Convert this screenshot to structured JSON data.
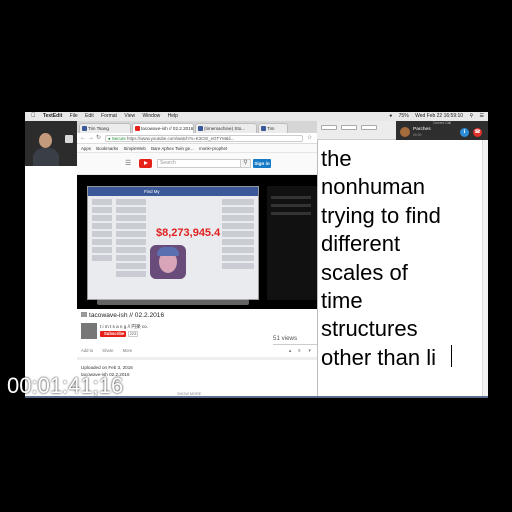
{
  "menubar": {
    "app": "TextEdit",
    "items": [
      "File",
      "Edit",
      "Format",
      "View",
      "Window",
      "Help"
    ],
    "clock": "Wed Feb 22  16:59:10",
    "battery": "75%"
  },
  "browser": {
    "tabs": [
      {
        "label": "Tim Tsang",
        "color": "#3b5998"
      },
      {
        "label": "tacowave-ish // 02.2.2016",
        "color": "#e62117"
      },
      {
        "label": "(timemachine) Sto...",
        "color": "#3b5998"
      },
      {
        "label": "Tim",
        "color": "#3b5998"
      }
    ],
    "secure_label": "Secure",
    "url": "https://www.youtube.com/watch?v=K3C8r_eGTYM&li...",
    "bookmarks": [
      "Apps",
      "Bookmarks",
      "SimpleWeb",
      "Bare Aphex Twin ge...",
      "monk+prophet"
    ]
  },
  "youtube": {
    "search_placeholder": "Search",
    "signin_label": "Sign in",
    "video": {
      "overlay_amount": "$8,273,945.4",
      "facebook_title": "Find My"
    },
    "title": "tacowave-ish // 02.2.2016",
    "channel_name": "t i m t s a n g // 円楽 co.",
    "subscribe_label": "Subscribe",
    "subscriber_count": "223",
    "views": "51 views",
    "actions": [
      "Add to",
      "Share",
      "More"
    ],
    "likes": "9",
    "dislikes": "0",
    "uploaded": "Uploaded on Feb 3, 2016",
    "description": "tacowave-ish 02.2.2016",
    "show_more": "SHOW MORE"
  },
  "textedit": {
    "lines": [
      "the",
      "nonhuman",
      "trying to find",
      "different",
      "scales of",
      "time",
      "structures",
      "other than li"
    ]
  },
  "call": {
    "header": "Current Call",
    "name": "Parches",
    "sub": "00:00",
    "accept_color": "#2e8bd6",
    "decline_color": "#e0302a"
  },
  "timecode": "00:01:41;16"
}
